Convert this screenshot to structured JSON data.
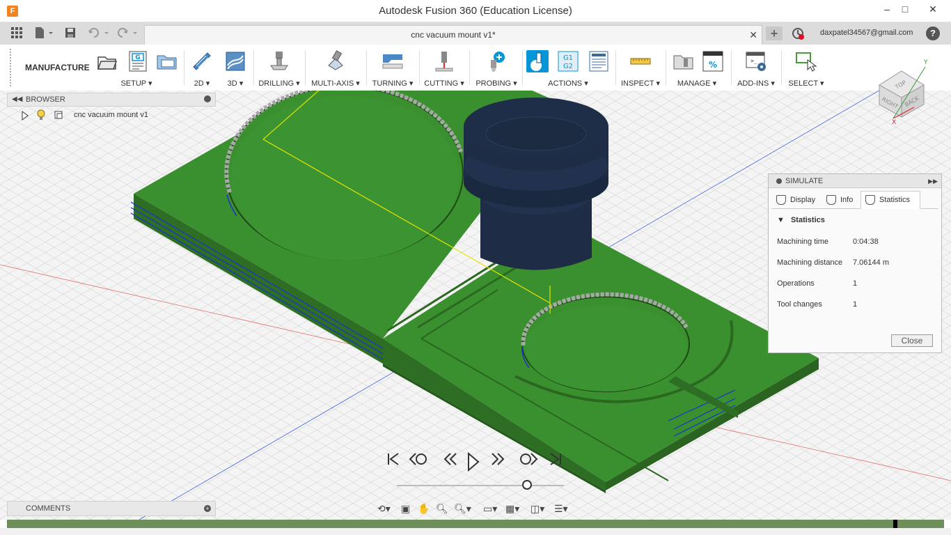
{
  "window": {
    "title": "Autodesk Fusion 360 (Education License)",
    "minimize": "–",
    "maximize": "□",
    "close": "✕"
  },
  "tabbar": {
    "doc_tab_label": "cnc vacuum mount v1*",
    "user_email": "daxpatel34567@gmail.com",
    "add_tab": "+",
    "help": "?"
  },
  "toolbar": {
    "workspace": "MANUFACTURE ▾",
    "groups": [
      {
        "label": "SETUP ▾"
      },
      {
        "label": "2D ▾"
      },
      {
        "label": "3D ▾"
      },
      {
        "label": "DRILLING ▾"
      },
      {
        "label": "MULTI-AXIS ▾"
      },
      {
        "label": "TURNING ▾"
      },
      {
        "label": "CUTTING ▾"
      },
      {
        "label": "PROBING ▾"
      },
      {
        "label": "ACTIONS ▾"
      },
      {
        "label": "INSPECT ▾"
      },
      {
        "label": "MANAGE ▾"
      },
      {
        "label": "ADD-INS ▾"
      },
      {
        "label": "SELECT ▾"
      }
    ]
  },
  "browser": {
    "title": "BROWSER",
    "item": "cnc vacuum mount v1"
  },
  "simulate": {
    "title": "SIMULATE",
    "tabs": [
      {
        "label": "Display"
      },
      {
        "label": "Info"
      },
      {
        "label": "Statistics"
      }
    ],
    "section": "Statistics",
    "stats": [
      {
        "label": "Machining time",
        "value": "0:04:38"
      },
      {
        "label": "Machining distance",
        "value": "7.06144 m"
      },
      {
        "label": "Operations",
        "value": "1"
      },
      {
        "label": "Tool changes",
        "value": "1"
      }
    ],
    "close_label": "Close"
  },
  "viewcube": {
    "top": "TOP",
    "right": "RIGHT",
    "back": "BACK",
    "x_axis": "X",
    "y_axis": "Y"
  },
  "comments": {
    "title": "COMMENTS"
  },
  "colors": {
    "part_green": "#3a8f2f",
    "part_dark": "#2d6e24",
    "tool_navy": "#1e2d45",
    "toolpath": "#1a2fd1",
    "accent_blue": "#0696d7"
  },
  "playback": {
    "position": 0.78
  }
}
